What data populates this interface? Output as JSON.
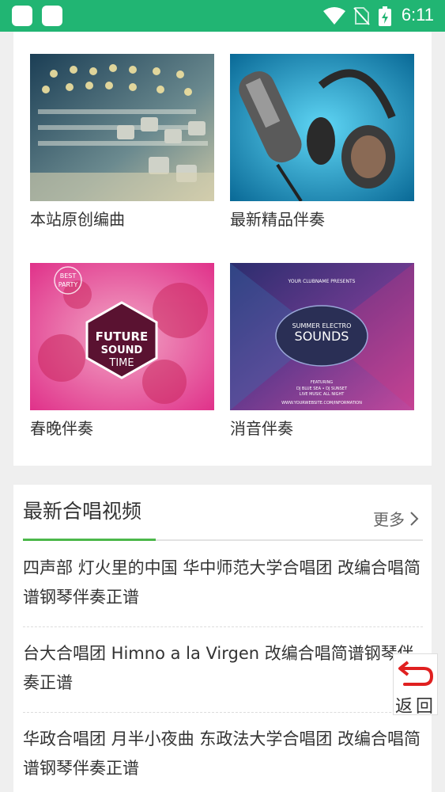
{
  "status_bar": {
    "time": "6:11"
  },
  "categories": [
    {
      "label": "本站原创编曲"
    },
    {
      "label": "最新精品伴奏"
    },
    {
      "label": "春晚伴奏",
      "art_text": [
        "BEST",
        "PARTY",
        "FUTURE",
        "SOUND",
        "TIME"
      ]
    },
    {
      "label": "消音伴奏",
      "art_text": [
        "YOUR CLUBNAME PRESENTS",
        "SUMMER ELECTRO",
        "SOUNDS",
        "FEATURING",
        "DJ BLUE SEA • DJ SUNSET",
        "LIVE MUSIC ALL NIGHT",
        "WWW.YOURWEBSITE.COM/INFORMATION"
      ]
    }
  ],
  "section": {
    "title": "最新合唱视频",
    "more_label": "更多",
    "items": [
      "四声部 灯火里的中国 华中师范大学合唱团 改编合唱简谱钢琴伴奏正谱",
      "台大合唱团 Himno a la Virgen 改编合唱简谱钢琴伴奏正谱",
      "华政合唱团 月半小夜曲 东政法大学合唱团 改编合唱简谱钢琴伴奏正谱"
    ]
  },
  "back_button": {
    "label": "返回"
  },
  "colors": {
    "status_bar": "#21b573",
    "accent_green": "#4cb84a",
    "back_arrow": "#e02020"
  }
}
